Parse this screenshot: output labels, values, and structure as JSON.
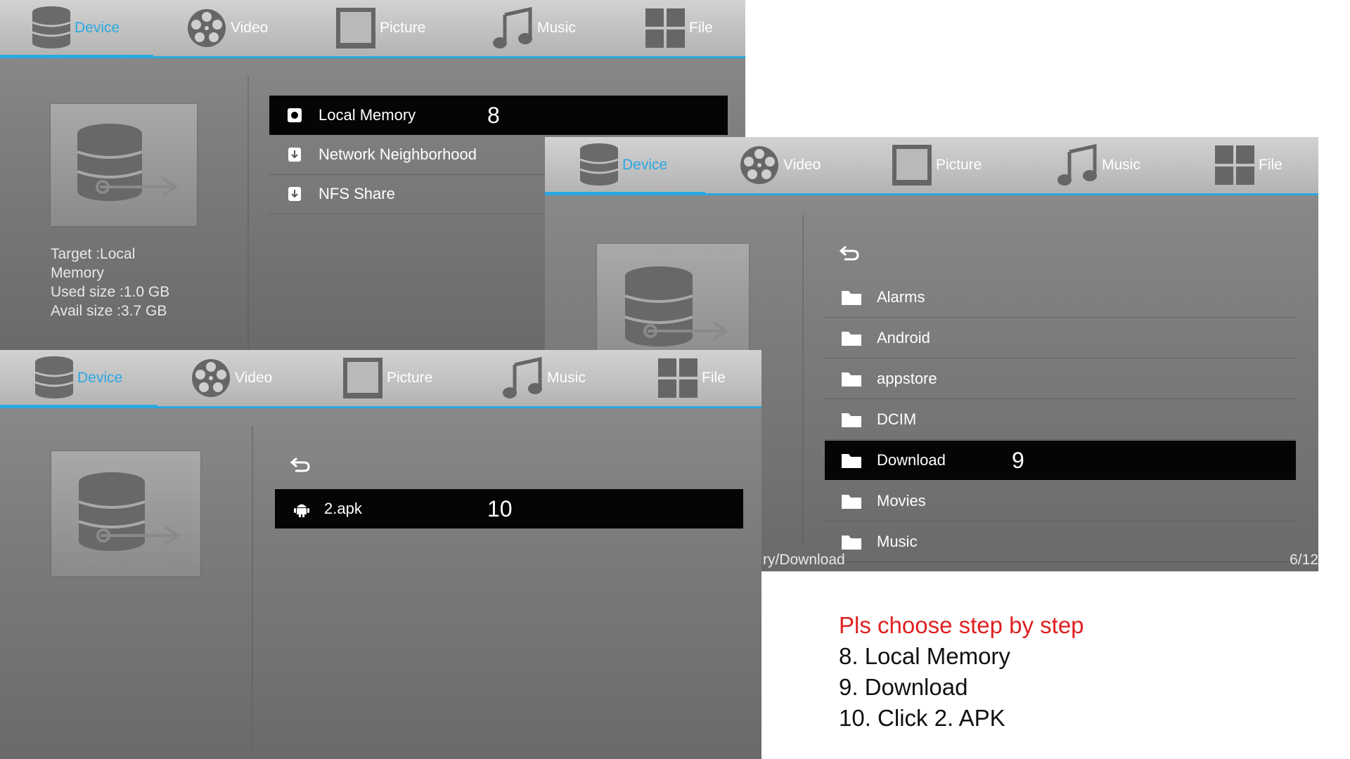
{
  "tabs": [
    {
      "label": "Device",
      "icon": "database-icon"
    },
    {
      "label": "Video",
      "icon": "film-reel-icon"
    },
    {
      "label": "Picture",
      "icon": "picture-frame-icon"
    },
    {
      "label": "Music",
      "icon": "music-note-icon"
    },
    {
      "label": "File",
      "icon": "grid-icon"
    }
  ],
  "screen1": {
    "devices": [
      {
        "label": "Local Memory",
        "icon": "sd-card-icon",
        "step": "8"
      },
      {
        "label": "Network Neighborhood",
        "icon": "network-icon"
      },
      {
        "label": "NFS Share",
        "icon": "network-icon"
      }
    ],
    "info": {
      "target_line1": "Target :Local",
      "target_line2": "Memory",
      "used": "Used size :1.0 GB",
      "avail": "Avail size :3.7 GB"
    }
  },
  "screen2": {
    "folders": [
      {
        "label": "Alarms"
      },
      {
        "label": "Android"
      },
      {
        "label": "appstore"
      },
      {
        "label": "DCIM"
      },
      {
        "label": "Download",
        "step": "9"
      },
      {
        "label": "Movies"
      },
      {
        "label": "Music"
      }
    ],
    "path": "ry/Download",
    "page": "6/12"
  },
  "screen3": {
    "files": [
      {
        "label": "2.apk",
        "icon": "android-icon",
        "step": "10"
      }
    ]
  },
  "instructions": {
    "heading": "Pls choose step by step",
    "lines": [
      "8. Local Memory",
      "9. Download",
      "10. Click 2. APK"
    ]
  },
  "colors": {
    "accent": "#29a9e0",
    "heading": "#e02020",
    "selected_row": "#050505"
  }
}
